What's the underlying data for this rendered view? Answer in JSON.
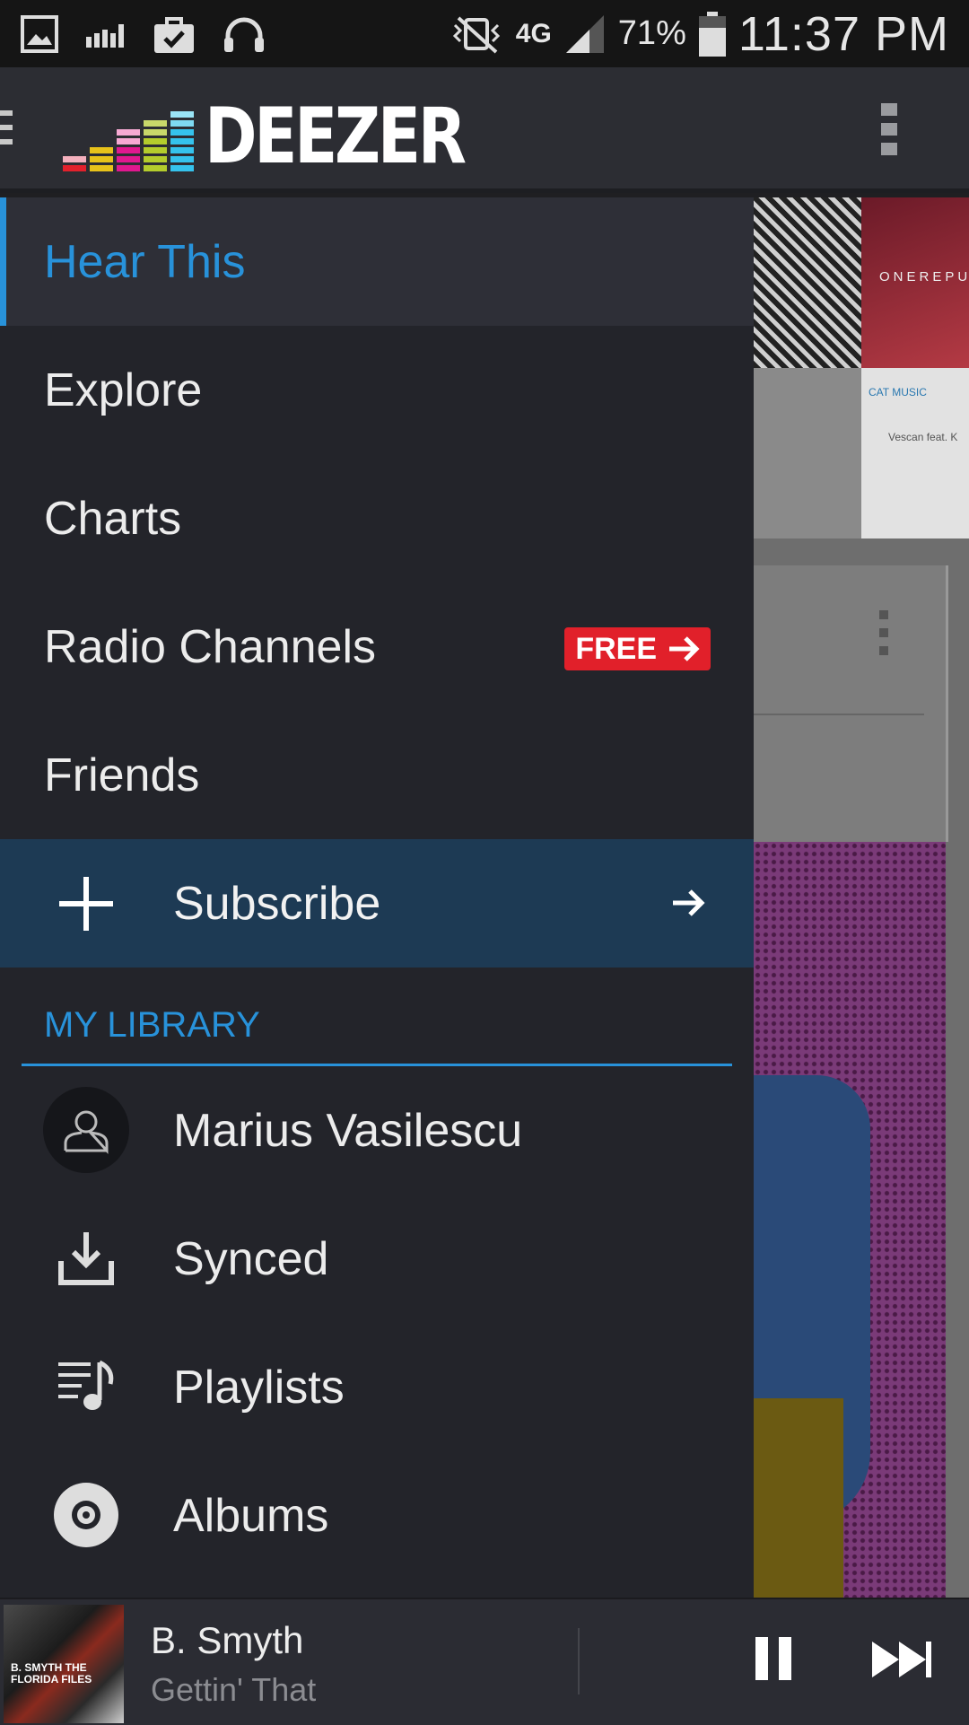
{
  "status_bar": {
    "network": "4G",
    "battery": "71%",
    "time": "11:37 PM"
  },
  "app_bar": {
    "logo_text": "DEEZER"
  },
  "drawer": {
    "nav": [
      {
        "label": "Hear This",
        "active": true
      },
      {
        "label": "Explore"
      },
      {
        "label": "Charts"
      },
      {
        "label": "Radio Channels",
        "badge": "FREE"
      },
      {
        "label": "Friends"
      }
    ],
    "subscribe_label": "Subscribe",
    "library_header": "MY LIBRARY",
    "library": [
      {
        "label": "Marius Vasilescu",
        "icon": "profile-avatar-icon"
      },
      {
        "label": "Synced",
        "icon": "download-icon"
      },
      {
        "label": "Playlists",
        "icon": "playlist-icon"
      },
      {
        "label": "Albums",
        "icon": "album-icon"
      }
    ]
  },
  "background_content": {
    "tile_text": "ONEREPU",
    "tile_label": "CAT MUSIC",
    "tile_caption": "Vescan feat. K"
  },
  "player": {
    "artist": "B. Smyth",
    "track": "Gettin' That",
    "cover_text": "B. SMYTH THE FLORIDA FILES"
  },
  "colors": {
    "accent": "#2892da",
    "drawer_bg": "#23242a",
    "subscribe_bg": "#1d3a54",
    "badge_red": "#e1202a"
  }
}
